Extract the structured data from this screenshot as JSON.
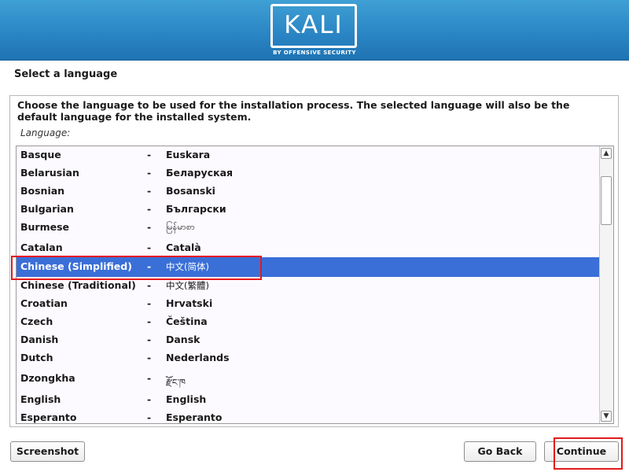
{
  "header": {
    "logo_text": "KALI",
    "logo_subtitle": "BY OFFENSIVE SECURITY",
    "banner_color": "#2b86c5"
  },
  "page": {
    "title": "Select a language",
    "description": "Choose the language to be used for the installation process. The selected language will also be the default language for the installed system.",
    "field_label": "Language:"
  },
  "languages": [
    {
      "name": "Basque",
      "native": "Euskara"
    },
    {
      "name": "Belarusian",
      "native": "Беларуская"
    },
    {
      "name": "Bosnian",
      "native": "Bosanski"
    },
    {
      "name": "Bulgarian",
      "native": "Български"
    },
    {
      "name": "Burmese",
      "native": "မြန်မာစာ"
    },
    {
      "name": "Catalan",
      "native": "Català"
    },
    {
      "name": "Chinese (Simplified)",
      "native": "中文(简体)"
    },
    {
      "name": "Chinese (Traditional)",
      "native": "中文(繁體)"
    },
    {
      "name": "Croatian",
      "native": "Hrvatski"
    },
    {
      "name": "Czech",
      "native": "Čeština"
    },
    {
      "name": "Danish",
      "native": "Dansk"
    },
    {
      "name": "Dutch",
      "native": "Nederlands"
    },
    {
      "name": "Dzongkha",
      "native": "རྫོང་ཁ"
    },
    {
      "name": "English",
      "native": "English"
    },
    {
      "name": "Esperanto",
      "native": "Esperanto"
    }
  ],
  "list": {
    "separator": "-",
    "selected_language": "Chinese (Simplified)",
    "selection_color": "#3a6fd8"
  },
  "scrollbar": {
    "up_icon": "▲",
    "down_icon": "▼"
  },
  "buttons": {
    "screenshot": "Screenshot",
    "go_back": "Go Back",
    "continue": "Continue"
  },
  "annotations": {
    "highlight_color": "#e31a1a"
  }
}
